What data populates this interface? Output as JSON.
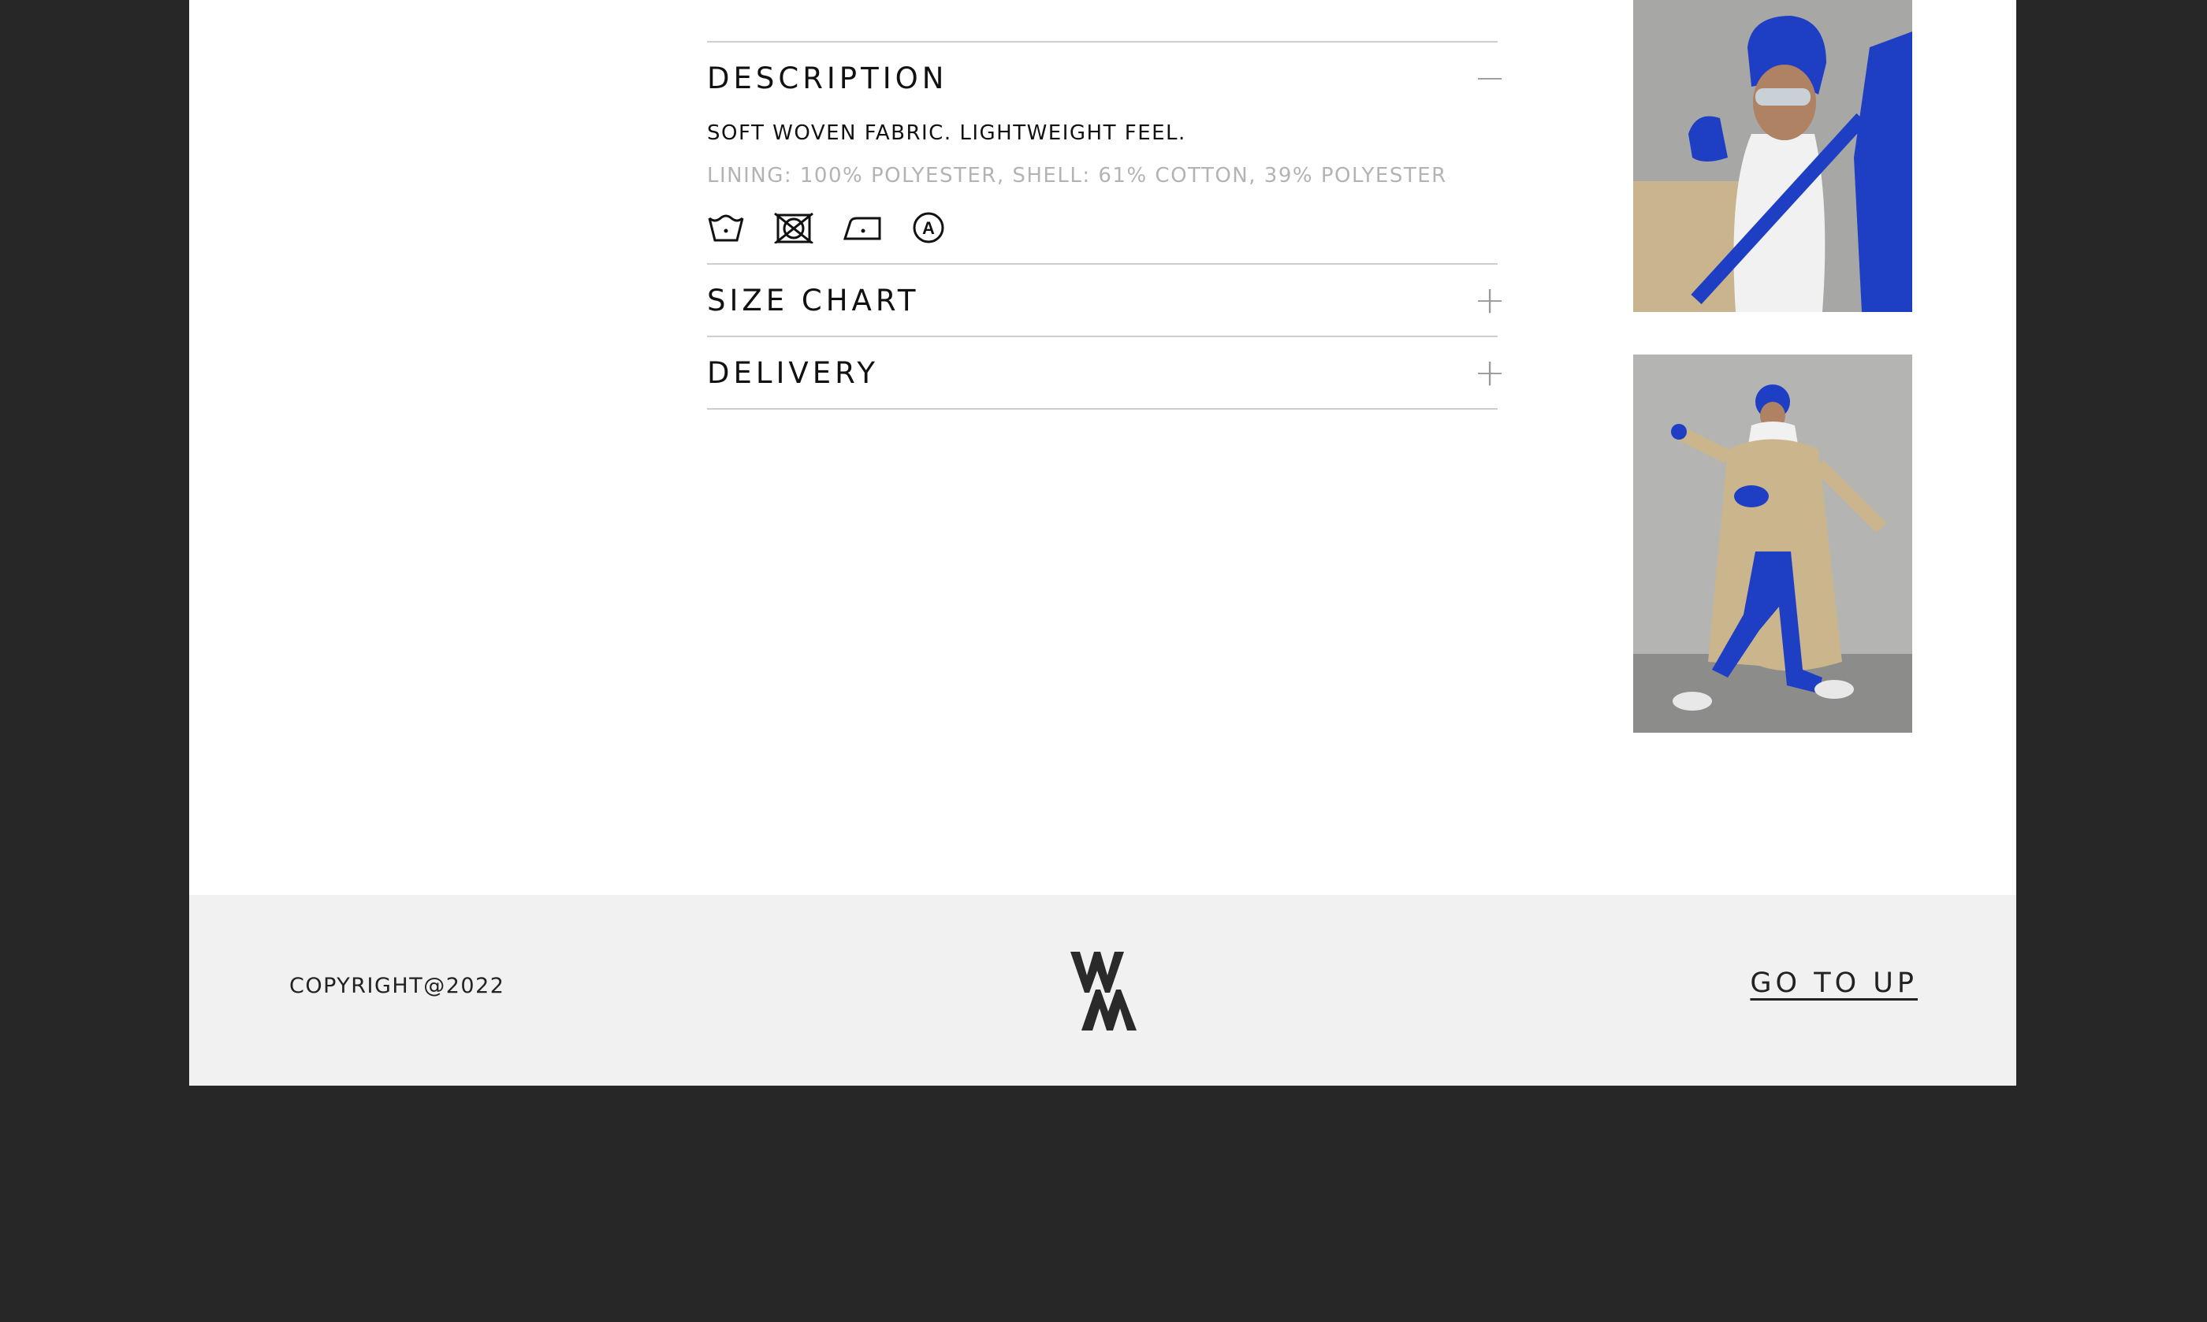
{
  "accordion": {
    "description": {
      "title": "DESCRIPTION",
      "toggle": "−",
      "expanded": true,
      "text": "SOFT WOVEN FABRIC. LIGHTWEIGHT FEEL.",
      "composition": "LINING: 100% POLYESTER, SHELL: 61% COTTON, 39% POLYESTER",
      "care_icons": [
        "wash-30-icon",
        "do-not-tumble-dry-icon",
        "iron-low-icon",
        "dry-clean-a-icon"
      ]
    },
    "size_chart": {
      "title": "SIZE CHART",
      "toggle": "+",
      "expanded": false
    },
    "delivery": {
      "title": "DELIVERY",
      "toggle": "+",
      "expanded": false
    }
  },
  "gallery": {
    "images": [
      "model-closeup-photo",
      "model-full-body-photo"
    ]
  },
  "footer": {
    "copyright": "COPYRIGHT@2022",
    "logo": "brand-logo",
    "go_up": "GO TO UP"
  },
  "colors": {
    "background": "#272727",
    "page": "#ffffff",
    "footer": "#f1f1f1",
    "accent_blue": "#1f45d6",
    "muted_text": "#b3b3b3"
  }
}
